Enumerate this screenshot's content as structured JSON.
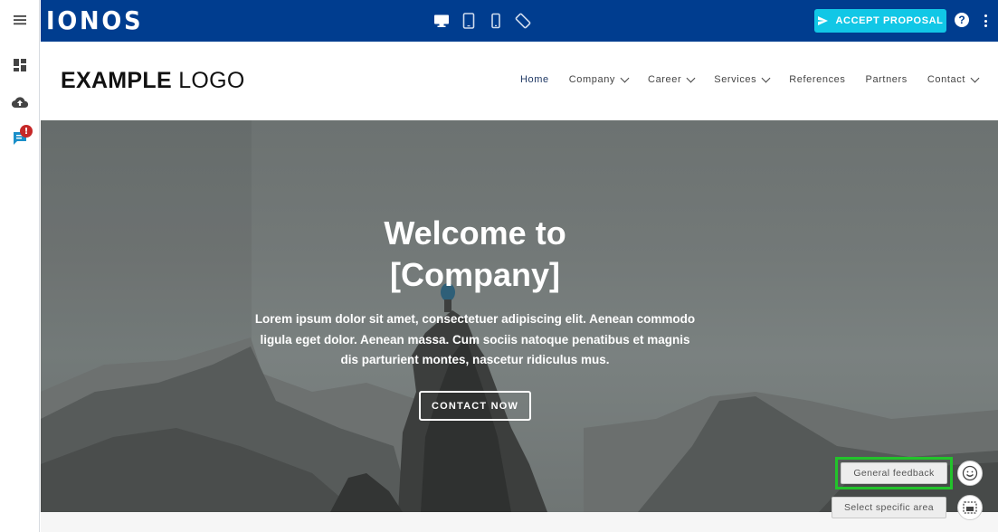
{
  "topbar": {
    "brand": "IONOS",
    "accept_label": "ACCEPT PROPOSAL",
    "help_label": "?",
    "devices": [
      "desktop-icon",
      "tablet-icon",
      "mobile-icon",
      "rotate-icon"
    ]
  },
  "sidebar": {
    "items": [
      "menu-icon",
      "dashboard-icon",
      "cloud-upload-icon",
      "chat-icon"
    ],
    "badge": "!"
  },
  "site": {
    "logo_bold": "EXAMPLE",
    "logo_light": "LOGO",
    "nav": [
      {
        "label": "Home",
        "dropdown": false
      },
      {
        "label": "Company",
        "dropdown": true
      },
      {
        "label": "Career",
        "dropdown": true
      },
      {
        "label": "Services",
        "dropdown": true
      },
      {
        "label": "References",
        "dropdown": false
      },
      {
        "label": "Partners",
        "dropdown": false
      },
      {
        "label": "Contact",
        "dropdown": true
      }
    ]
  },
  "hero": {
    "title_line1": "Welcome to",
    "title_line2": "[Company]",
    "text": "Lorem ipsum dolor sit amet, consectetuer adipiscing elit. Aenean commodo ligula eget dolor. Aenean massa. Cum sociis natoque penatibus et magnis dis parturient montes, nascetur ridiculus mus.",
    "button": "CONTACT NOW"
  },
  "feedback": {
    "general": "General feedback",
    "area": "Select specific area"
  },
  "colors": {
    "topbar": "#003d8f",
    "accent": "#11c7e6",
    "highlight": "#22c32b"
  }
}
